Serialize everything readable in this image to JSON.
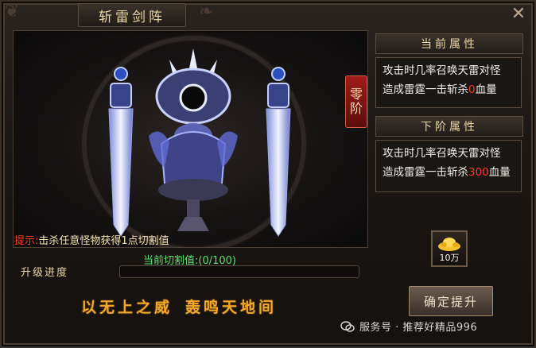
{
  "window": {
    "title": "斩雷剑阵"
  },
  "stage": {
    "rank_char1": "零",
    "rank_char2": "阶"
  },
  "tip": {
    "label": "提示:",
    "text": "击杀任意怪物获得1点切割值"
  },
  "progress": {
    "label_prefix": "当前切割值:",
    "value_text": "(0/100)",
    "current": 0,
    "max": 100,
    "bar_label": "升级进度"
  },
  "slogan": {
    "part1": "以无上之威",
    "part2": "轰鸣天地间"
  },
  "current_attr": {
    "header": "当前属性",
    "line1": "攻击时几率召唤天雷对怪",
    "line2_prefix": "造成雷霆一击斩杀",
    "line2_value": "0",
    "line2_suffix": "血量"
  },
  "next_attr": {
    "header": "下阶属性",
    "line1": "攻击时几率召唤天雷对怪",
    "line2_prefix": "造成雷霆一击斩杀",
    "line2_value": "300",
    "line2_suffix": "血量"
  },
  "reward": {
    "icon": "gold-ingot-icon",
    "count": "10万"
  },
  "buttons": {
    "confirm": "确定提升"
  },
  "watermark": {
    "text": "服务号 · 推荐好精品996"
  },
  "colors": {
    "accent_gold": "#f2a92b",
    "highlight_red": "#ff3a2a",
    "progress_green": "#5fe070"
  }
}
